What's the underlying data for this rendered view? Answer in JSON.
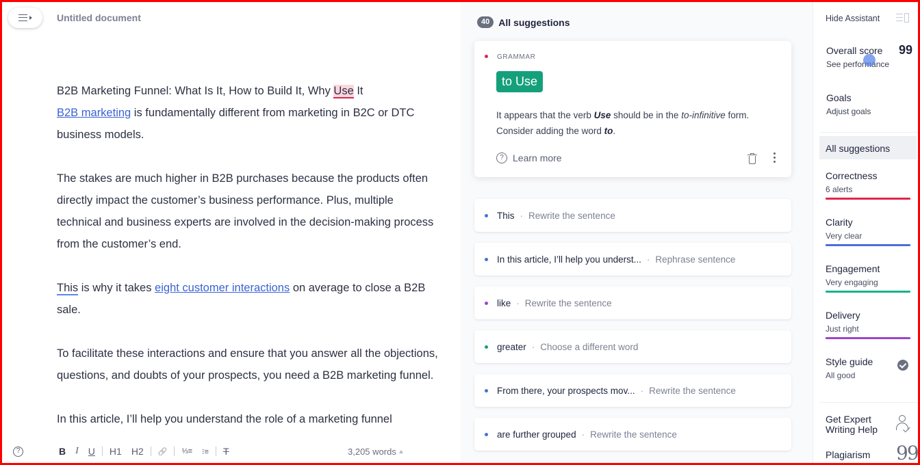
{
  "editor": {
    "title": "Untitled document",
    "paragraphs": {
      "p1": {
        "line1_before": "B2B Marketing Funnel: What Is It, How to Build It, Why ",
        "line1_mark": "Use",
        "line1_after": " It",
        "link": "B2B marketing",
        "rest": " is fundamentally different from marketing in B2C or DTC business models."
      },
      "p2": "The stakes are much higher in B2B purchases because the products often directly impact the customer’s business performance. Plus, multiple technical and business experts are involved in the decision-making process from the customer’s end.",
      "p3": {
        "mark": "This",
        "before_link": " is why it takes ",
        "link": "eight customer interactions",
        "after_link": " on average to close a B2B sale."
      },
      "p4": "To facilitate these interactions and ensure that you answer all the objections, questions, and doubts of your prospects, you need a B2B marketing funnel.",
      "p5_partial": "In this article, I’ll help you understand the role of a marketing funnel"
    },
    "toolbar": {
      "help": "?",
      "bold": "B",
      "italic": "I",
      "underline": "U",
      "h1": "H1",
      "h2": "H2",
      "link": "🔗",
      "ordered_list": "⅓≡",
      "bullet_list": "⁝≡",
      "clear_format": "T",
      "word_count": "3,205 words"
    }
  },
  "suggestions": {
    "count": "40",
    "header": "All suggestions",
    "active_card": {
      "category": "GRAMMAR",
      "fix": "to Use",
      "message_1": "It appears that the verb ",
      "message_word": "Use",
      "message_2": " should be in the ",
      "message_form": "to-infinitive",
      "message_3": " form. Consider adding the word ",
      "message_add": "to",
      "message_4": ".",
      "learn_more": "Learn more"
    },
    "items": [
      {
        "word": "This",
        "hint": "Rewrite the sentence",
        "color": "#4a6fd8"
      },
      {
        "word": "In this article, I’ll help you underst...",
        "hint": "Rephrase sentence",
        "color": "#4a6fd8"
      },
      {
        "word": "like",
        "hint": "Rewrite the sentence",
        "color": "#9b45c9"
      },
      {
        "word": "greater",
        "hint": "Choose a different word",
        "color": "#15a07c"
      },
      {
        "word": "From there, your prospects mov...",
        "hint": "Rewrite the sentence",
        "color": "#4a6fd8"
      },
      {
        "word": "are further grouped",
        "hint": "Rewrite the sentence",
        "color": "#4a6fd8"
      }
    ],
    "separator": "·"
  },
  "assistant": {
    "hide_label": "Hide Assistant",
    "overall_score_label": "Overall score",
    "overall_score": "99",
    "see_performance": "See performance",
    "goals_label": "Goals",
    "goals_sub": "Adjust goals",
    "all_suggestions": "All suggestions",
    "categories": [
      {
        "label": "Correctness",
        "sub": "6 alerts",
        "color": "#e0264f"
      },
      {
        "label": "Clarity",
        "sub": "Very clear",
        "color": "#4a6fd8"
      },
      {
        "label": "Engagement",
        "sub": "Very engaging",
        "color": "#15b38f"
      },
      {
        "label": "Delivery",
        "sub": "Just right",
        "color": "#9b45c9"
      },
      {
        "label": "Style guide",
        "sub": "All good",
        "color": ""
      }
    ],
    "expert_line1": "Get Expert",
    "expert_line2": "Writing Help",
    "plagiarism": "Plagiarism",
    "plagiarism_icon": "99"
  }
}
